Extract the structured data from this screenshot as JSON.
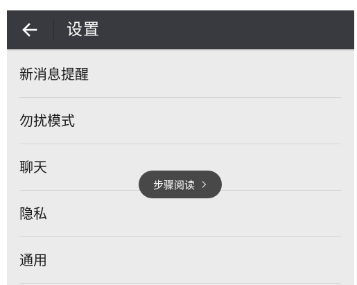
{
  "header": {
    "title": "设置",
    "back_icon": "arrow-left-icon"
  },
  "settings_list": {
    "items": [
      {
        "label": "新消息提醒"
      },
      {
        "label": "勿扰模式"
      },
      {
        "label": "聊天"
      },
      {
        "label": "隐私"
      },
      {
        "label": "通用"
      }
    ]
  },
  "overlay": {
    "label": "步骤阅读",
    "icon": "chevron-right-icon"
  },
  "colors": {
    "header_bg": "#393a3f",
    "list_bg": "#ebebeb",
    "divider": "#d4d4d4",
    "text": "#1a1a1a"
  }
}
